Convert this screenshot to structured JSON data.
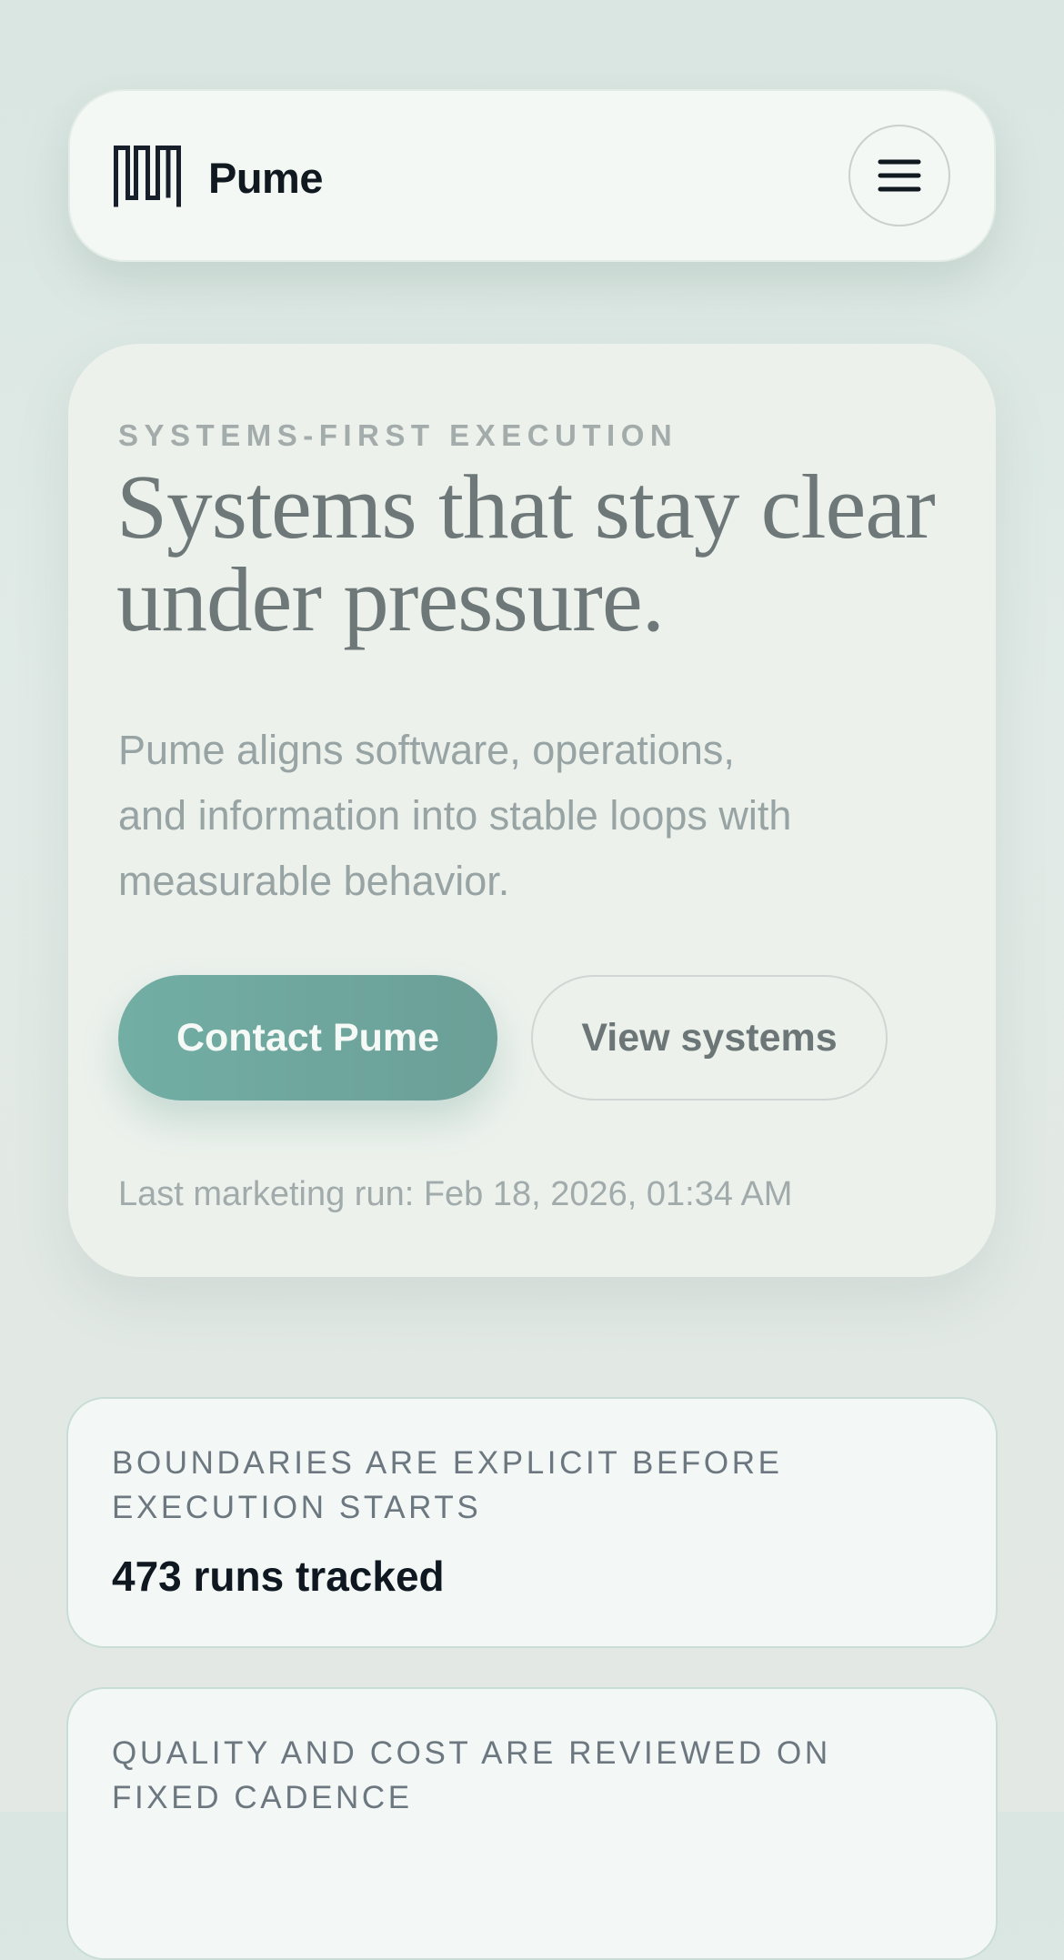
{
  "header": {
    "brand": "Pume",
    "menu_icon": "hamburger-menu-icon"
  },
  "hero": {
    "eyebrow": "SYSTEMS-FIRST EXECUTION",
    "title": "Systems that stay clear under pressure.",
    "description": "Pume aligns software, operations, and information into stable loops with measurable behavior.",
    "primary_cta": "Contact Pume",
    "secondary_cta": "View systems",
    "last_run": "Last marketing run: Feb 18, 2026, 01:34 AM"
  },
  "stats": [
    {
      "label": "BOUNDARIES ARE EXPLICIT BEFORE EXECUTION STARTS",
      "value": "473 runs tracked"
    },
    {
      "label": "QUALITY AND COST ARE REVIEWED ON FIXED CADENCE",
      "value": ""
    }
  ],
  "colors": {
    "accent": "#6fa89f",
    "background": "#dce7e3",
    "card": "#f4f8f4",
    "text_dark": "#101820"
  }
}
